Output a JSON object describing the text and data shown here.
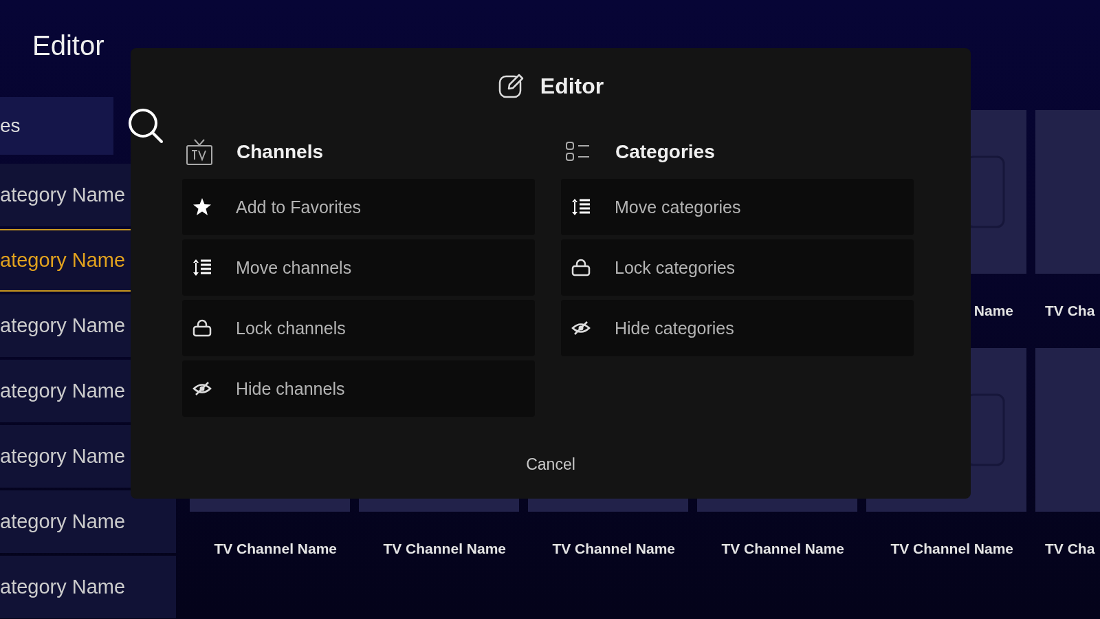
{
  "sidebar": {
    "title": "Editor",
    "search": {
      "value": "es"
    },
    "categories": [
      {
        "label": "ategory Name",
        "selected": false
      },
      {
        "label": "ategory Name",
        "selected": true
      },
      {
        "label": "ategory Name",
        "selected": false
      },
      {
        "label": "ategory Name",
        "selected": false
      },
      {
        "label": "ategory Name",
        "selected": false
      },
      {
        "label": "ategory Name",
        "selected": false
      },
      {
        "label": "ategory Name",
        "selected": false
      }
    ]
  },
  "grid": {
    "rows": [
      {
        "labels": [
          "Name",
          "TV Cha"
        ]
      },
      {
        "labels": [
          "TV Channel Name",
          "TV Channel Name",
          "TV Channel Name",
          "TV Channel Name",
          "TV Channel Name",
          "TV Cha"
        ]
      }
    ]
  },
  "dialog": {
    "title": "Editor",
    "columns": [
      {
        "title": "Channels",
        "items": [
          {
            "kind": "favorite",
            "label": "Add to Favorites"
          },
          {
            "kind": "move",
            "label": "Move channels"
          },
          {
            "kind": "lock",
            "label": "Lock channels"
          },
          {
            "kind": "hide",
            "label": "Hide channels"
          }
        ]
      },
      {
        "title": "Categories",
        "items": [
          {
            "kind": "move",
            "label": "Move categories"
          },
          {
            "kind": "lock",
            "label": "Lock categories"
          },
          {
            "kind": "hide",
            "label": "Hide categories"
          }
        ]
      }
    ],
    "cancel": "Cancel"
  }
}
